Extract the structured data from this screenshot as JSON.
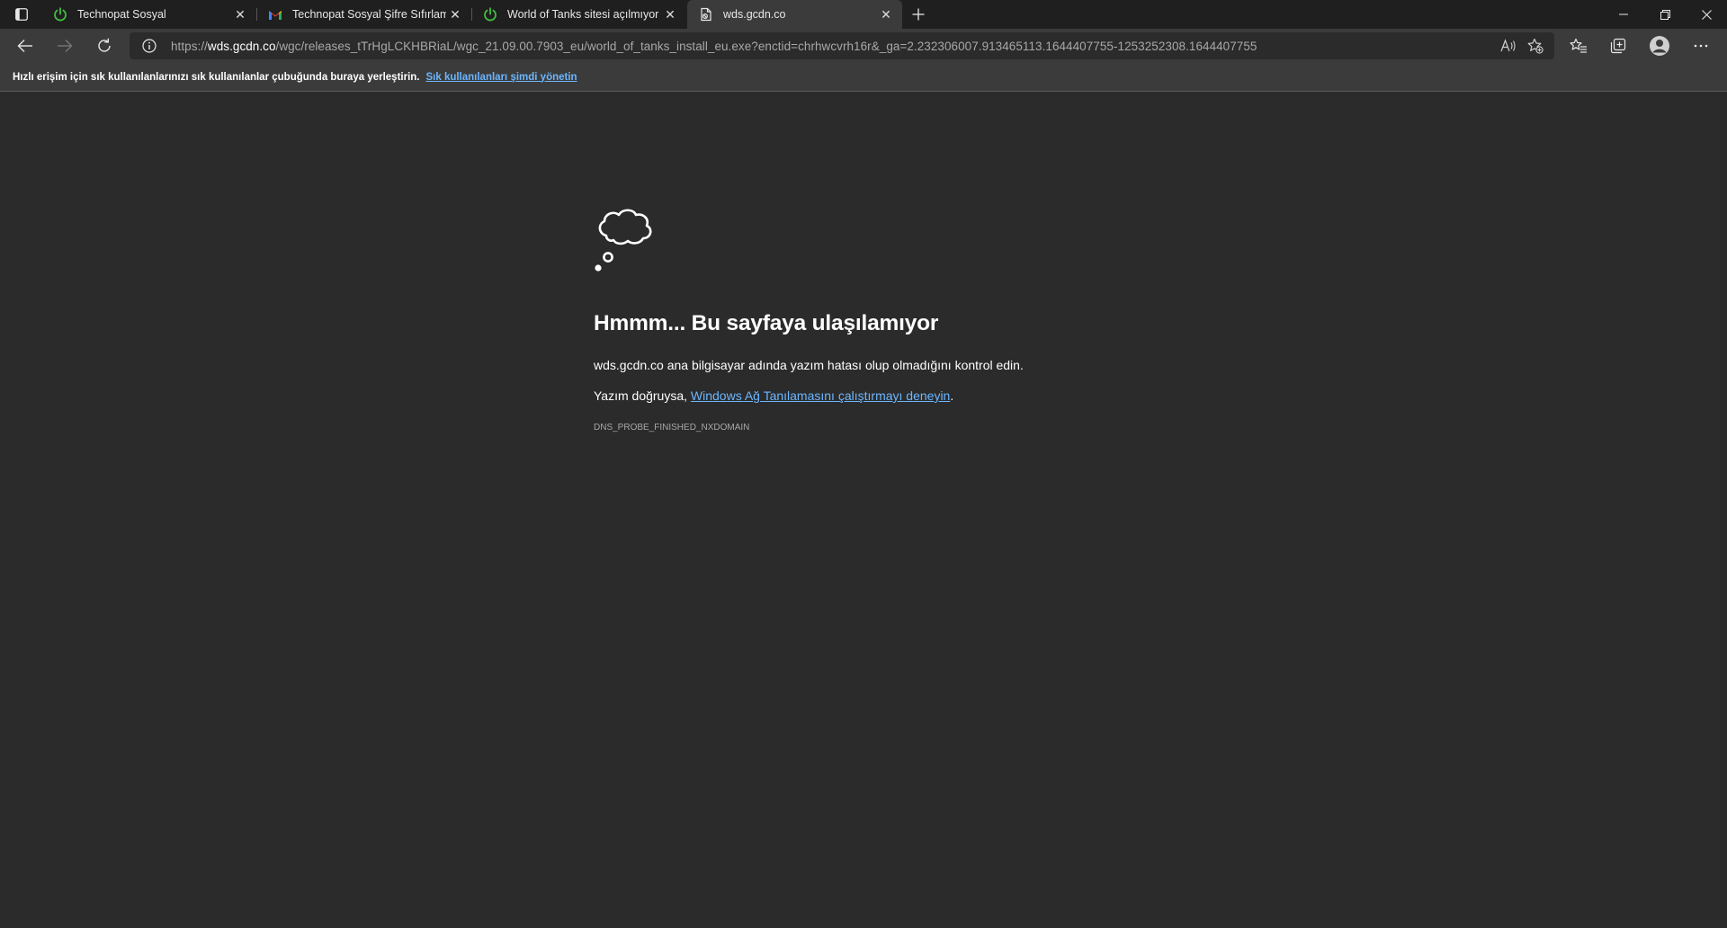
{
  "tabs": [
    {
      "title": "Technopat Sosyal",
      "icon": "power-icon"
    },
    {
      "title": "Technopat Sosyal Şifre Sıfırlama",
      "icon": "gmail-icon"
    },
    {
      "title": "World of Tanks sitesi açılmıyor \"DNS",
      "icon": "power-icon"
    },
    {
      "title": "wds.gcdn.co",
      "icon": "broken-page-icon",
      "active": true
    }
  ],
  "address_bar": {
    "scheme": "https://",
    "host": "wds.gcdn.co",
    "path": "/wgc/releases_tTrHgLCKHBRiaL/wgc_21.09.00.7903_eu/world_of_tanks_install_eu.exe?enctid=chrhwcvrh16r&_ga=2.232306007.913465113.1644407755-1253252308.1644407755"
  },
  "favorites_bar": {
    "hint": "Hızlı erişim için sık kullanılanlarınızı sık kullanılanlar çubuğunda buraya yerleştirin.",
    "manage_link": "Sık kullanılanları şimdi yönetin"
  },
  "error_page": {
    "title": "Hmmm... Bu sayfaya ulaşılamıyor",
    "description": "wds.gcdn.co ana bilgisayar adında yazım hatası olup olmadığını kontrol edin.",
    "suggestion_prefix": "Yazım doğruysa, ",
    "suggestion_link": "Windows Ağ Tanılamasını çalıştırmayı deneyin",
    "suggestion_suffix": ".",
    "error_code": "DNS_PROBE_FINISHED_NXDOMAIN"
  },
  "colors": {
    "tabstrip_bg": "#1f1f1f",
    "toolbar_bg": "#3b3b3b",
    "page_bg": "#2b2b2b",
    "link": "#6cb6ff",
    "power_icon": "#3fbf3f"
  }
}
